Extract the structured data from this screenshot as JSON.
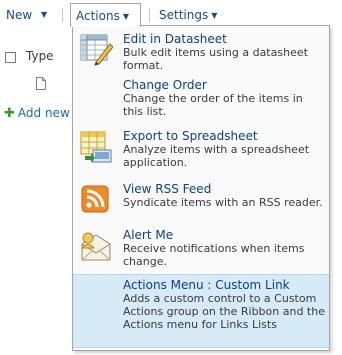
{
  "toolbar": {
    "new_label": "New",
    "actions_label": "Actions",
    "settings_label": "Settings"
  },
  "list": {
    "type_header": "Type",
    "add_new_label": "Add new"
  },
  "menu": {
    "items": [
      {
        "title": "Edit in Datasheet",
        "description": "Bulk edit items using a datasheet format.",
        "icon": "datasheet-icon"
      },
      {
        "title": "Change Order",
        "description": "Change the order of the items in this list.",
        "icon": ""
      },
      {
        "title": "Export to Spreadsheet",
        "description": "Analyze items with a spreadsheet application.",
        "icon": "spreadsheet-export-icon"
      },
      {
        "title": "View RSS Feed",
        "description": "Syndicate items with an RSS reader.",
        "icon": "rss-icon"
      },
      {
        "title": "Alert Me",
        "description": "Receive notifications when items change.",
        "icon": "alert-icon"
      },
      {
        "title": "Actions Menu : Custom Link",
        "description": "Adds a custom control to a Custom Actions group on the Ribbon and the Actions menu for Links Lists",
        "icon": ""
      }
    ]
  },
  "colors": {
    "link_blue": "#0f3e8a",
    "hover_background": "#d6eaf8",
    "rss_orange": "#f08a24"
  }
}
